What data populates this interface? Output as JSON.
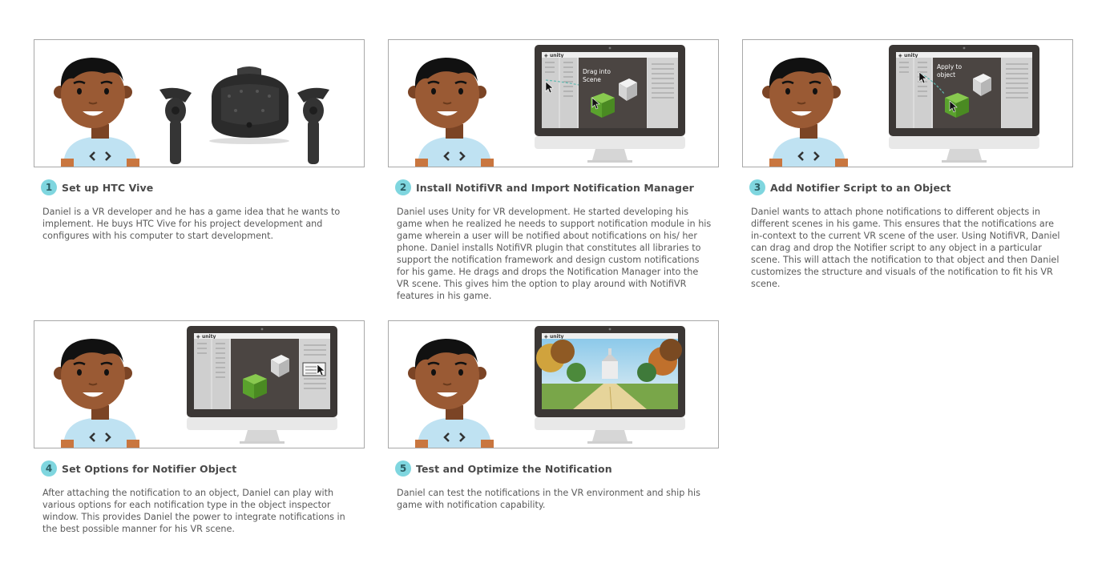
{
  "steps": [
    {
      "number": "1",
      "title": "Set up HTC Vive",
      "description": "Daniel is a VR developer and he has a game idea that he wants to implement. He buys HTC Vive for his project development and configures with his computer to start development."
    },
    {
      "number": "2",
      "title": "Install NotifiVR and Import Notification Manager",
      "description": "Daniel uses Unity for VR development. He started developing his game when he realized he needs to support notification module in his game wherein a user will be notified about notifications on his/ her phone. Daniel installs NotifiVR plugin that constitutes all libraries to support the notification framework and design custom notifications for his game. He drags and drops the Notification Manager into the VR scene. This gives him the option to play around with NotifiVR features in his game.",
      "caption_line1": "Drag into",
      "caption_line2": "Scene"
    },
    {
      "number": "3",
      "title": "Add Notifier Script to an Object",
      "description": "Daniel wants to attach phone notifications to different objects in different scenes in his game. This ensures that the notifications are in-context to the current VR scene of the user. Using NotifiVR, Daniel can drag and drop the Notifier script to any object in a particular scene. This will attach the notification to that object and then Daniel customizes the structure and visuals of the notification to fit his VR scene.",
      "caption_line1": "Apply to",
      "caption_line2": "object"
    },
    {
      "number": "4",
      "title": "Set Options for Notifier Object",
      "description": "After attaching the notification to an object, Daniel can play with various options for each notification type in the object inspector window. This provides Daniel the power to integrate notifications in the best possible manner for his VR scene."
    },
    {
      "number": "5",
      "title": "Test and Optimize the Notification",
      "description": "Daniel can test the notifications in the VR environment and ship his game with notification capability."
    }
  ],
  "app_logo": "unity",
  "colors": {
    "badge": "#7fd6df",
    "skin": "#9a5a34",
    "hair": "#111111",
    "shirt": "#bfe2f2",
    "monitor_bezel": "#3b3735",
    "monitor_chin": "#e8e8e8",
    "scene_bg": "#4b4542",
    "cube_green": "#6cb338"
  },
  "icons": [
    "developer-avatar",
    "vr-controller-icon",
    "vr-headset-icon",
    "monitor-icon",
    "cursor-icon",
    "cube-icon"
  ]
}
